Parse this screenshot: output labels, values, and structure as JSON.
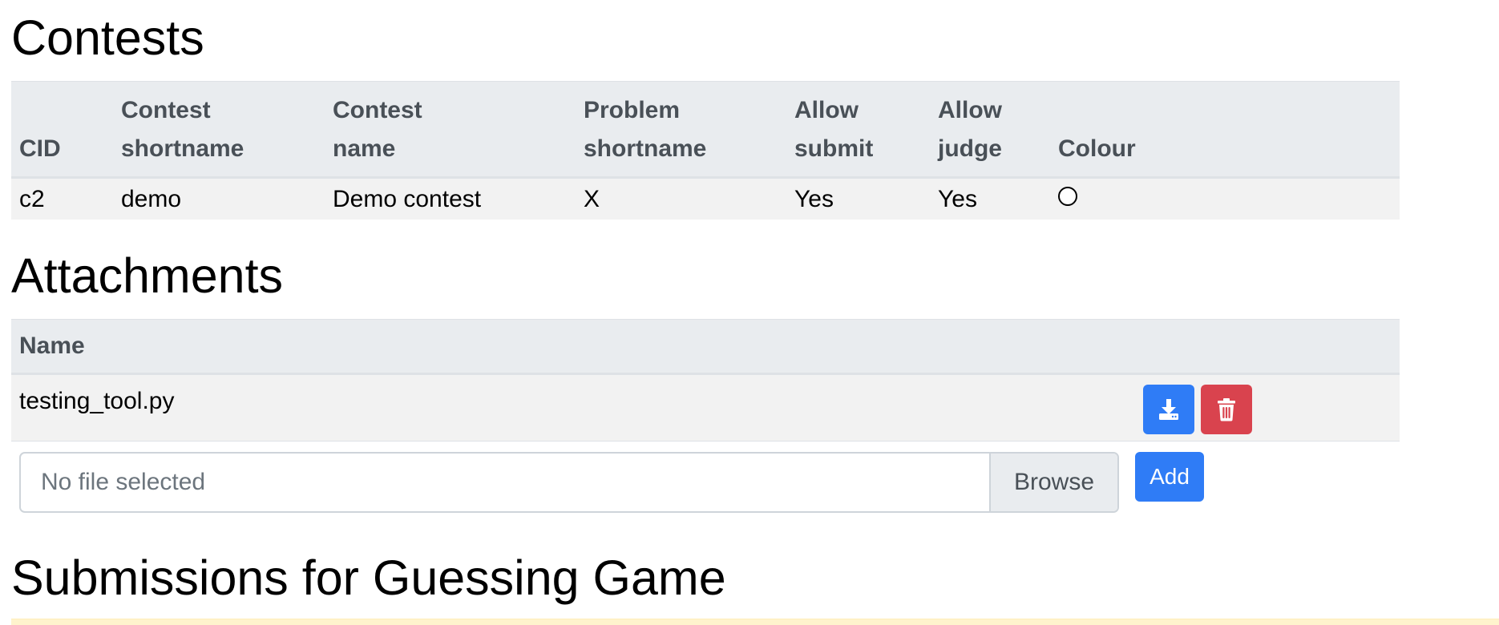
{
  "contests": {
    "heading": "Contests",
    "columns": [
      {
        "line1": "",
        "line2": "CID"
      },
      {
        "line1": "Contest",
        "line2": "shortname"
      },
      {
        "line1": "Contest",
        "line2": "name"
      },
      {
        "line1": "Problem",
        "line2": "shortname"
      },
      {
        "line1": "Allow",
        "line2": "submit"
      },
      {
        "line1": "Allow",
        "line2": "judge"
      },
      {
        "line1": "",
        "line2": "Colour"
      }
    ],
    "rows": [
      {
        "cid": "c2",
        "contest_shortname": "demo",
        "contest_name": "Demo contest",
        "problem_shortname": "X",
        "allow_submit": "Yes",
        "allow_judge": "Yes",
        "colour": "#ffffff"
      }
    ]
  },
  "attachments": {
    "heading": "Attachments",
    "column_name": "Name",
    "rows": [
      {
        "name": "testing_tool.py",
        "download_icon": "download-icon",
        "delete_icon": "trash-icon"
      }
    ],
    "upload": {
      "placeholder": "No file selected",
      "browse_label": "Browse",
      "add_label": "Add"
    }
  },
  "submissions": {
    "heading": "Submissions for Guessing Game"
  },
  "colors": {
    "primary": "#2f7cf6",
    "danger": "#d9434e",
    "table_header_bg": "#e9ecef",
    "row_bg": "#f2f2f2",
    "alert_bg": "#fff3cd"
  }
}
